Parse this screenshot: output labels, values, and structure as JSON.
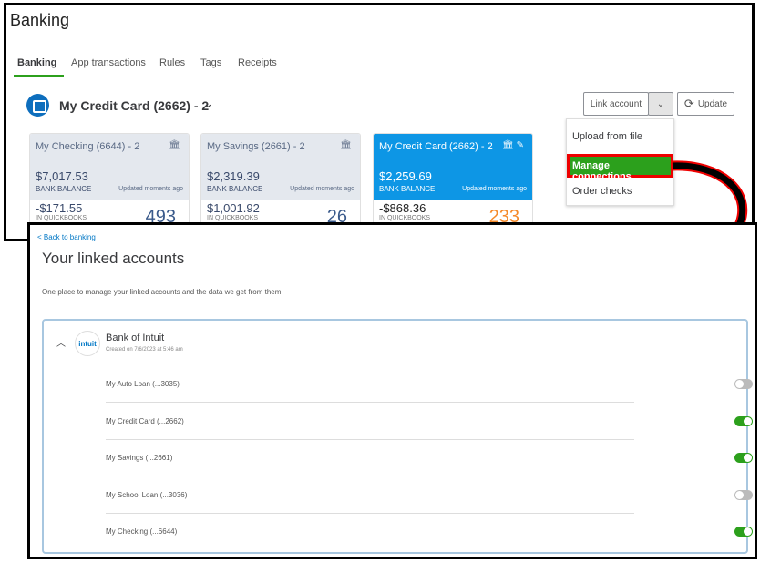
{
  "header": {
    "title": "Banking"
  },
  "tabs": [
    {
      "label": "Banking",
      "active": true
    },
    {
      "label": "App transactions"
    },
    {
      "label": "Rules"
    },
    {
      "label": "Tags"
    },
    {
      "label": "Receipts"
    }
  ],
  "account_selector": {
    "label": "My Credit Card (2662) - 2"
  },
  "cards": [
    {
      "name": "My Checking (6644) - 2",
      "bank_balance": "$7,017.53",
      "bank_label": "BANK BALANCE",
      "updated": "Updated moments ago",
      "qb_balance": "-$171.55",
      "qb_label": "IN QUICKBOOKS",
      "count": "493"
    },
    {
      "name": "My Savings (2661) - 2",
      "bank_balance": "$2,319.39",
      "bank_label": "BANK BALANCE",
      "updated": "Updated moments ago",
      "qb_balance": "$1,001.92",
      "qb_label": "IN QUICKBOOKS",
      "count": "26"
    },
    {
      "name": "My Credit Card (2662) - 2",
      "bank_balance": "$2,259.69",
      "bank_label": "BANK BALANCE",
      "updated": "Updated moments ago",
      "qb_balance": "-$868.36",
      "qb_label": "IN QUICKBOOKS",
      "count": "233"
    }
  ],
  "toolbar": {
    "link_account": "Link account",
    "update": "Update"
  },
  "menu": {
    "items": [
      "Upload from file",
      "Manage connections",
      "Order checks"
    ]
  },
  "linked": {
    "back": "< Back to banking",
    "title": "Your linked accounts",
    "subtitle": "One place to manage your linked accounts and the data we get from them.",
    "bank": {
      "name": "Bank of Intuit",
      "logo": "intuit",
      "created": "Created on 7/6/2023 at 5:46 am"
    },
    "accounts": [
      {
        "label": "My Auto Loan (...3035)",
        "enabled": false
      },
      {
        "label": "My Credit Card (...2662)",
        "enabled": true
      },
      {
        "label": "My Savings (...2661)",
        "enabled": true
      },
      {
        "label": "My School Loan (...3036)",
        "enabled": false
      },
      {
        "label": "My Checking (...6644)",
        "enabled": true
      }
    ]
  },
  "colors": {
    "accent": "#2ca01c",
    "card_active": "#0d96e5",
    "highlight": "#ee0000"
  }
}
